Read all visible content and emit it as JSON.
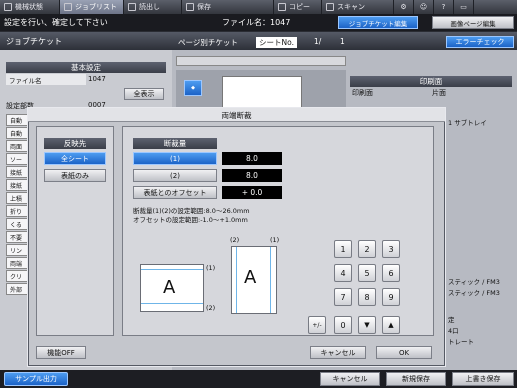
{
  "top_tabs": [
    {
      "label": "機械状態"
    },
    {
      "label": "ジョブリスト"
    },
    {
      "label": "読出し"
    },
    {
      "label": "保存"
    },
    {
      "label": "コピー"
    },
    {
      "label": "スキャン"
    }
  ],
  "status": {
    "message": "設定を行い、確定して下さい",
    "file_name": "ファイル名：1047"
  },
  "mode_tabs": {
    "job_ticket_edit": "ジョブチケット編集",
    "image_page_edit": "画像ページ編集"
  },
  "left_panel": {
    "header": "ジョブチケット",
    "basic_settings": "基本設定",
    "file_name_label": "ファイル名",
    "file_name_value": "1047",
    "show_all": "全表示",
    "setting_label": "設定部数",
    "setting_value": "0007",
    "side_rows": [
      "自動",
      "自動",
      "両面",
      "ソー",
      "接紙",
      "接紙",
      "上積",
      "折り",
      "くる",
      "不要",
      "リン",
      "両端",
      "クリ",
      "外部"
    ]
  },
  "right_panel": {
    "page_ticket": "ページ別チケット",
    "sheet_no_label": "シートNo.",
    "sheet_no": "1/",
    "sheet_total": "1",
    "error_check": "エラーチェック",
    "print_side_header": "印刷面",
    "print_side_label": "印刷面",
    "print_side_value": "片面",
    "side_tray": "1 サブトレイ",
    "tray_lines": [
      "スティック / FM3",
      "スティック / FM3"
    ],
    "bottom_labels": [
      "定",
      "4口",
      "トレート"
    ]
  },
  "dialog": {
    "title": "両端断裁",
    "apply_to_header": "反映先",
    "all_sheets": "全シート",
    "cover_only": "表紙のみ",
    "cut_amount_header": "断裁量",
    "cut1_label": "(1)",
    "cut1_value": "8.0",
    "cut2_label": "(2)",
    "cut2_value": "8.0",
    "cover_offset_label": "表紙とのオフセット",
    "cover_offset_value": "+ 0.0",
    "info_line1": "断裁量(1)(2)の設定範囲:8.0〜26.0mm",
    "info_line2": "オフセットの設定範囲:-1.0〜+1.0mm",
    "diagram_letter_left": "A",
    "diagram_letter_right": "A",
    "diagram_mark1": "(1)",
    "diagram_mark2": "(2)",
    "diagram_top_mark2": "(2)",
    "diagram_top_mark1": "(1)",
    "keypad": [
      "1",
      "2",
      "3",
      "4",
      "5",
      "6",
      "7",
      "8",
      "9"
    ],
    "plus_minus": "+/-",
    "zero": "0",
    "function_off": "機能OFF",
    "cancel": "キャンセル",
    "ok": "OK"
  },
  "bottom_bar": {
    "sample_output": "サンプル出力",
    "cancel": "キャンセル",
    "save_new": "新規保存",
    "overwrite": "上書き保存"
  }
}
